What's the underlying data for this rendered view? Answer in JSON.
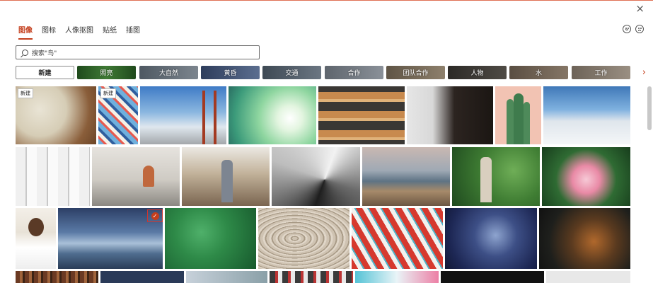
{
  "tabs": [
    {
      "label": "图像",
      "active": true
    },
    {
      "label": "图标",
      "active": false
    },
    {
      "label": "人像抠图",
      "active": false
    },
    {
      "label": "贴纸",
      "active": false
    },
    {
      "label": "插图",
      "active": false
    }
  ],
  "search": {
    "value": "搜索\"鸟\""
  },
  "close_glyph": "×",
  "categories": [
    {
      "label": "新建",
      "color": "#ffffff"
    },
    {
      "label": "照亮",
      "color": "#2f5e2a"
    },
    {
      "label": "大自然",
      "color": "#59636d"
    },
    {
      "label": "黄昏",
      "color": "#3b4a66"
    },
    {
      "label": "交通",
      "color": "#4d5864"
    },
    {
      "label": "合作",
      "color": "#6a7078"
    },
    {
      "label": "团队合作",
      "color": "#6f6354"
    },
    {
      "label": "人物",
      "color": "#3c3a36"
    },
    {
      "label": "水",
      "color": "#6b5e52"
    },
    {
      "label": "工作",
      "color": "#7a7066"
    }
  ],
  "new_badge": "新建",
  "checkmark": "✓",
  "photos": {
    "row1": [
      "painting-supplies",
      "patterned-wallpaper",
      "golden-gate-bridge",
      "white-flowers",
      "baguettes",
      "man-beard",
      "cactus-on-pink",
      "snowy-mountains"
    ],
    "row2": [
      "cotton-swabs-jars",
      "office-woman-laptop",
      "lumber-yard-worker",
      "spiral-staircase",
      "coastline-aerial",
      "woman-watering-plants",
      "pink-plumeria"
    ],
    "row3": [
      "smiling-doctor",
      "icebergs-dusk",
      "green-leaves",
      "wood-grain",
      "red-white-umbrellas",
      "blueberries",
      "tiger-in-dark"
    ]
  }
}
